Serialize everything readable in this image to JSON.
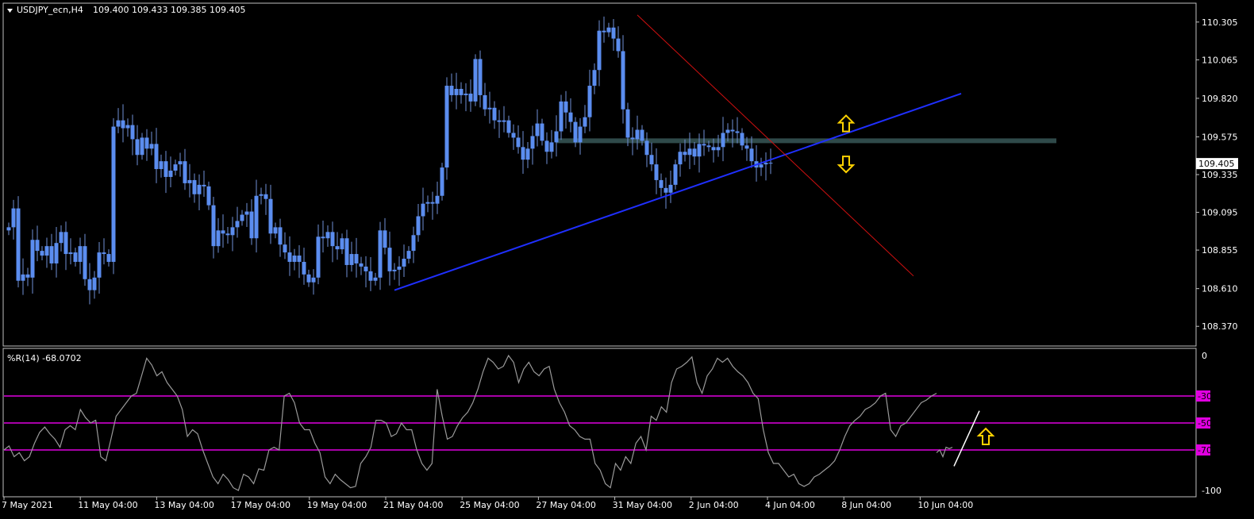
{
  "colors": {
    "background": "#000000",
    "frame": "#c0c0c0",
    "candle": "#5b8def",
    "wick": "#6f8fd6",
    "trendline_blue": "#1f2fff",
    "trendline_red": "#d01010",
    "level_line": "#2f4a4a",
    "wpr_line": "#9a9a9a",
    "wpr_levels": "#e000e0",
    "arrow": "#ffd200"
  },
  "chart_data": [
    {
      "type": "candlestick",
      "title": "USDJPY_ecn,H4",
      "ohlc_label": "109.400 109.433 109.385 109.405",
      "current_price": "109.405",
      "ylim": [
        108.25,
        110.42
      ],
      "yticks": [
        "110.305",
        "110.065",
        "109.820",
        "109.575",
        "109.335",
        "109.095",
        "108.855",
        "108.610",
        "108.370"
      ],
      "xtick_labels": [
        "7 May 2021",
        "11 May 04:00",
        "13 May 04:00",
        "17 May 04:00",
        "19 May 04:00",
        "21 May 04:00",
        "25 May 04:00",
        "27 May 04:00",
        "31 May 04:00",
        "2 Jun 04:00",
        "4 Jun 04:00",
        "8 Jun 04:00",
        "10 Jun 04:00"
      ],
      "closes": [
        109.0,
        109.12,
        108.66,
        108.7,
        108.68,
        108.92,
        108.85,
        108.82,
        108.88,
        108.77,
        108.9,
        108.97,
        108.83,
        108.84,
        108.78,
        108.88,
        108.67,
        108.6,
        108.68,
        108.84,
        108.83,
        108.78,
        109.64,
        109.68,
        109.63,
        109.65,
        109.56,
        109.46,
        109.57,
        109.5,
        109.53,
        109.37,
        109.42,
        109.32,
        109.36,
        109.4,
        109.42,
        109.28,
        109.3,
        109.21,
        109.27,
        109.26,
        109.14,
        108.88,
        108.98,
        108.96,
        108.95,
        109.0,
        109.04,
        109.08,
        109.1,
        108.93,
        109.2,
        109.21,
        109.18,
        108.96,
        109.0,
        108.89,
        108.84,
        108.78,
        108.82,
        108.78,
        108.7,
        108.65,
        108.68,
        108.94,
        108.93,
        108.97,
        108.88,
        108.86,
        108.93,
        108.76,
        108.83,
        108.77,
        108.75,
        108.72,
        108.66,
        108.68,
        108.98,
        108.87,
        108.72,
        108.73,
        108.75,
        108.8,
        108.85,
        108.95,
        109.07,
        109.15,
        109.16,
        109.15,
        109.2,
        109.38,
        109.9,
        109.84,
        109.88,
        109.84,
        109.85,
        109.8,
        110.07,
        109.84,
        109.75,
        109.76,
        109.68,
        109.67,
        109.68,
        109.6,
        109.57,
        109.51,
        109.43,
        109.5,
        109.58,
        109.66,
        109.55,
        109.48,
        109.54,
        109.61,
        109.8,
        109.73,
        109.67,
        109.54,
        109.64,
        109.7,
        109.9,
        110.0,
        110.25,
        110.24,
        110.27,
        110.2,
        110.12,
        109.75,
        109.57,
        109.56,
        109.62,
        109.55,
        109.46,
        109.4,
        109.3,
        109.25,
        109.22,
        109.27,
        109.4,
        109.48,
        109.46,
        109.5,
        109.45,
        109.53,
        109.52,
        109.51,
        109.49,
        109.51,
        109.6,
        109.62,
        109.61,
        109.6,
        109.52,
        109.5,
        109.42,
        109.38,
        109.4,
        109.41,
        109.405
      ],
      "sr_level": 109.55,
      "trendlines": [
        {
          "color": "blue",
          "from": {
            "bar": 81,
            "price": 108.6
          },
          "to": {
            "bar": 200,
            "price": 109.85
          }
        },
        {
          "color": "red",
          "from": {
            "bar": 132,
            "price": 110.35
          },
          "to": {
            "bar": 190,
            "price": 108.69
          }
        }
      ],
      "arrows": [
        {
          "direction": "up",
          "bar": 175,
          "price": 109.66
        },
        {
          "direction": "down",
          "bar": 175,
          "price": 109.4
        }
      ]
    },
    {
      "type": "line",
      "title": "%R(14) -68.0702",
      "ylim": [
        -100,
        0
      ],
      "yticks": [
        "0",
        "-30",
        "-50",
        "-70",
        "-100"
      ],
      "level_values": [
        -30,
        -50,
        -70
      ],
      "level_labels": [
        "-30",
        "-50",
        "-70"
      ],
      "values": [
        -70,
        -67,
        -75,
        -72,
        -78,
        -75,
        -65,
        -57,
        -53,
        -58,
        -62,
        -68,
        -55,
        -52,
        -55,
        -40,
        -46,
        -50,
        -48,
        -75,
        -78,
        -62,
        -45,
        -40,
        -35,
        -30,
        -28,
        -15,
        -2,
        -7,
        -15,
        -12,
        -20,
        -25,
        -30,
        -40,
        -60,
        -55,
        -58,
        -70,
        -80,
        -90,
        -95,
        -88,
        -92,
        -98,
        -100,
        -88,
        -90,
        -95,
        -84,
        -85,
        -70,
        -68,
        -70,
        -30,
        -28,
        -35,
        -50,
        -55,
        -55,
        -65,
        -72,
        -90,
        -95,
        -88,
        -92,
        -95,
        -98,
        -97,
        -80,
        -75,
        -68,
        -48,
        -48,
        -50,
        -60,
        -58,
        -50,
        -55,
        -55,
        -70,
        -80,
        -85,
        -80,
        -25,
        -45,
        -62,
        -60,
        -52,
        -46,
        -42,
        -35,
        -25,
        -12,
        -2,
        -5,
        -10,
        -8,
        0,
        -5,
        -20,
        -10,
        -5,
        -12,
        -15,
        -10,
        -8,
        -25,
        -35,
        -42,
        -52,
        -55,
        -60,
        -62,
        -62,
        -80,
        -85,
        -95,
        -98,
        -80,
        -85,
        -75,
        -80,
        -65,
        -60,
        -70,
        -45,
        -48,
        -38,
        -42,
        -20,
        -10,
        -8,
        -5,
        -1,
        -20,
        -28,
        -15,
        -10,
        -2,
        -5,
        -2,
        -8,
        -12,
        -15,
        -20,
        -28,
        -32,
        -55,
        -72,
        -80,
        -80,
        -85,
        -90,
        -88,
        -95,
        -97,
        -95,
        -90,
        -88,
        -85,
        -82,
        -78,
        -70,
        -60,
        -52,
        -48,
        -45,
        -40,
        -38,
        -35,
        -30,
        -28,
        -55,
        -60,
        -52,
        -50,
        -45,
        -40,
        -35,
        -33,
        -30,
        -28
      ],
      "tail_values": [
        -72,
        -70,
        -75,
        -68,
        -69,
        -68.07
      ]
    }
  ]
}
